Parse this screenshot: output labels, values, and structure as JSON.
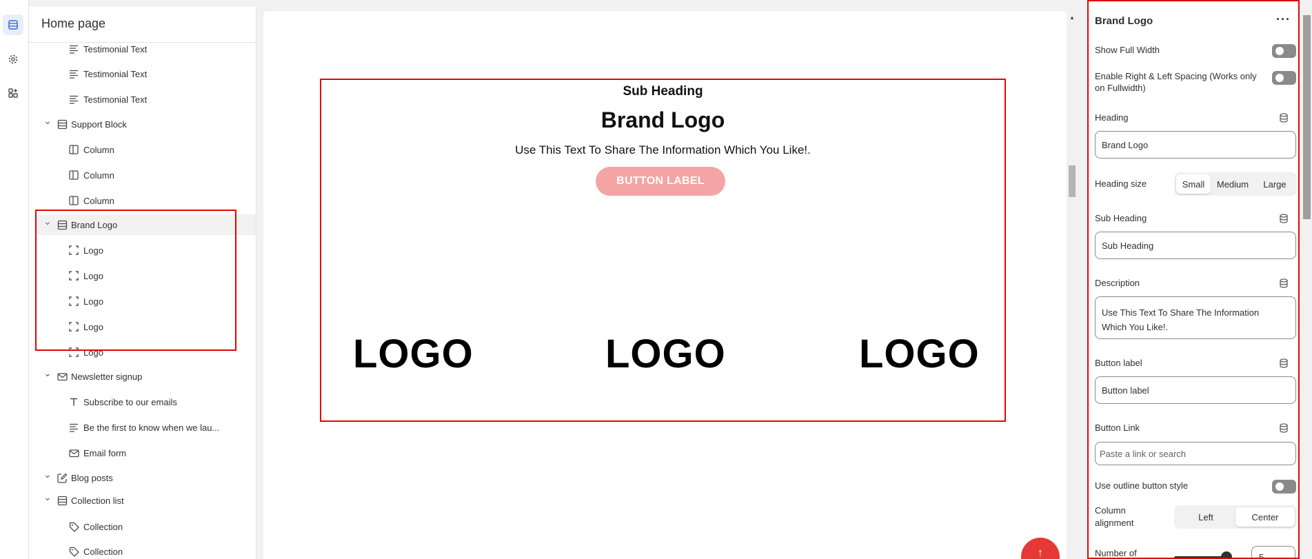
{
  "sidebar": {
    "title": "Home page",
    "items": [
      {
        "label": "Testimonial Text",
        "icon": "text-lines-icon",
        "level": 2
      },
      {
        "label": "Testimonial Text",
        "icon": "text-lines-icon",
        "level": 2
      },
      {
        "label": "Testimonial Text",
        "icon": "text-lines-icon",
        "level": 2
      },
      {
        "label": "Support Block",
        "icon": "section-icon",
        "level": 1
      },
      {
        "label": "Column",
        "icon": "column-icon",
        "level": 2
      },
      {
        "label": "Column",
        "icon": "column-icon",
        "level": 2
      },
      {
        "label": "Column",
        "icon": "column-icon",
        "level": 2
      },
      {
        "label": "Brand Logo",
        "icon": "section-icon",
        "level": 1
      },
      {
        "label": "Logo",
        "icon": "logo-block-icon",
        "level": 2
      },
      {
        "label": "Logo",
        "icon": "logo-block-icon",
        "level": 2
      },
      {
        "label": "Logo",
        "icon": "logo-block-icon",
        "level": 2
      },
      {
        "label": "Logo",
        "icon": "logo-block-icon",
        "level": 2
      },
      {
        "label": "Logo",
        "icon": "logo-block-icon",
        "level": 2
      },
      {
        "label": "Newsletter signup",
        "icon": "email-icon",
        "level": 1
      },
      {
        "label": "Subscribe to our emails",
        "icon": "heading-t-icon",
        "level": 2
      },
      {
        "label": "Be the first to know when we lau...",
        "icon": "text-lines-icon",
        "level": 2
      },
      {
        "label": "Email form",
        "icon": "email-icon",
        "level": 2
      },
      {
        "label": "Blog posts",
        "icon": "blog-edit-icon",
        "level": 1
      },
      {
        "label": "Collection list",
        "icon": "section-icon",
        "level": 1
      },
      {
        "label": "Collection",
        "icon": "tag-icon",
        "level": 2
      },
      {
        "label": "Collection",
        "icon": "tag-icon",
        "level": 2
      }
    ]
  },
  "preview": {
    "sub_heading": "Sub Heading",
    "heading": "Brand Logo",
    "description": "Use This Text To Share The Information Which You Like!.",
    "button_label": "BUTTON LABEL",
    "logos": [
      "LOGO",
      "LOGO",
      "LOGO"
    ],
    "fab_icon": "arrow-up-icon"
  },
  "settings": {
    "title": "Brand Logo",
    "more_label": "···",
    "show_full_width": {
      "label": "Show Full Width",
      "on": false
    },
    "spacing": {
      "label_line1": "Enable Right & Left Spacing (Works only",
      "label_line2": "on Fullwidth)",
      "on": false
    },
    "heading": {
      "label": "Heading",
      "value": "Brand Logo"
    },
    "heading_size": {
      "label": "Heading size",
      "options": [
        "Small",
        "Medium",
        "Large"
      ],
      "selected": "Small"
    },
    "sub_heading": {
      "label": "Sub Heading",
      "value": "Sub Heading"
    },
    "description": {
      "label": "Description",
      "value_line1": "Use This Text To Share The Information",
      "value_line2": "Which You Like!."
    },
    "button_label": {
      "label": "Button label",
      "value": "Button label"
    },
    "button_link": {
      "label": "Button Link",
      "placeholder": "Paste a link or search"
    },
    "outline_button": {
      "label": "Use outline button style",
      "on": false
    },
    "column_alignment": {
      "label_line1": "Column",
      "label_line2": "alignment",
      "options": [
        "Left",
        "Center"
      ],
      "selected": "Center"
    },
    "number_of": {
      "label_line1": "Number of",
      "value": "5"
    }
  },
  "colors": {
    "highlight": "#e10600",
    "button_pink": "#f4a4a4",
    "fab_red": "#e53935",
    "toggle_off": "#8a8a8a"
  }
}
